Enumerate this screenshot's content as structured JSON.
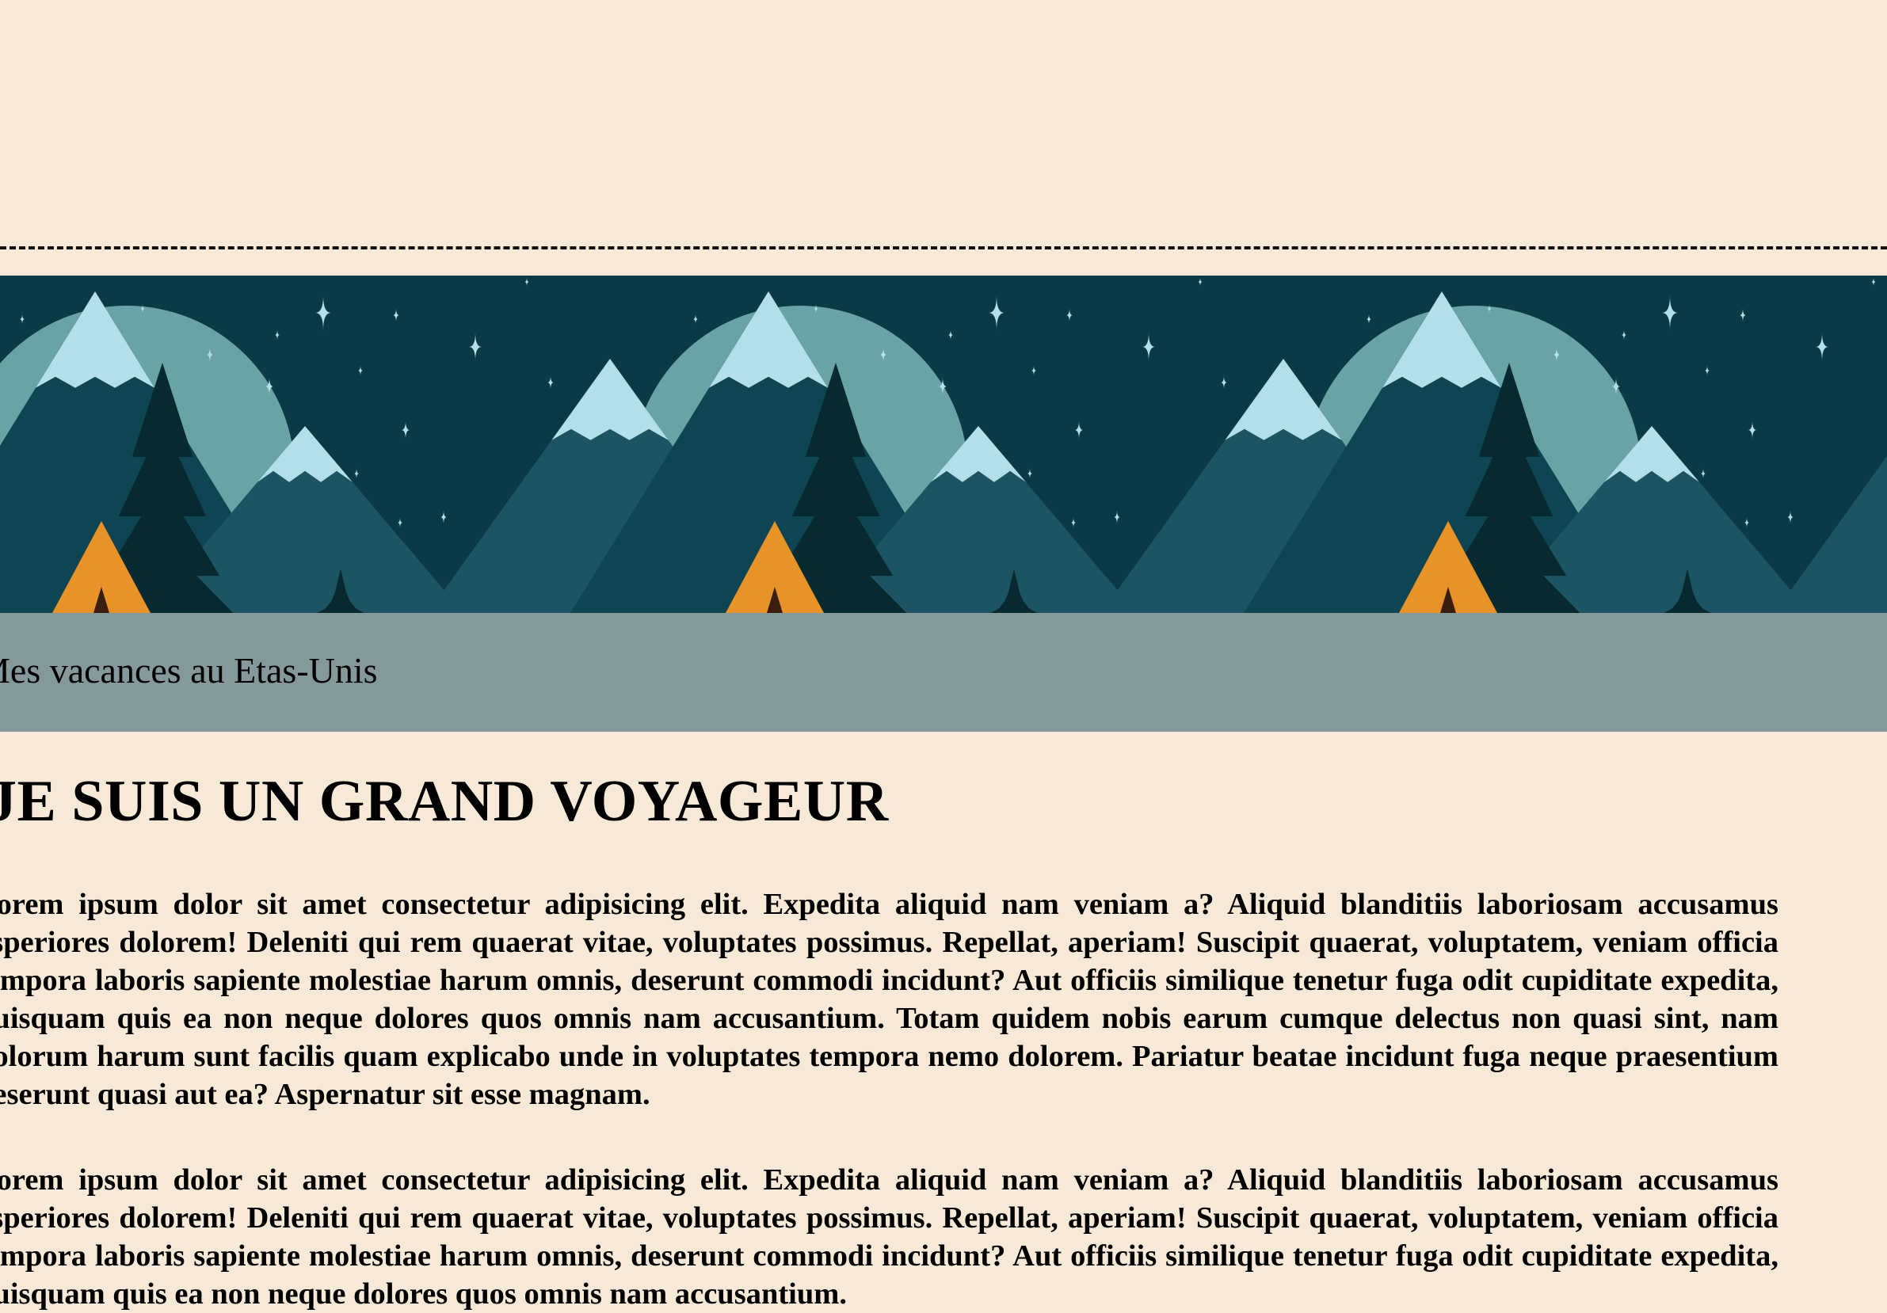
{
  "header": {
    "caption": "Mes vacances au Etas-Unis"
  },
  "main": {
    "title": "JE SUIS UN GRAND VOYAGEUR",
    "paragraphs": [
      "Lorem ipsum dolor sit amet consectetur adipisicing elit. Expedita aliquid nam veniam a? Aliquid blanditiis laboriosam accusamus asperiores dolorem! Deleniti qui rem quaerat vitae, voluptates possimus. Repellat, aperiam! Suscipit quaerat, voluptatem, veniam officia tempora laboris sapiente molestiae harum omnis, deserunt commodi incidunt? Aut officiis similique tenetur fuga odit cupiditate expedita, quisquam quis ea non neque dolores quos omnis nam accusantium. Totam quidem nobis earum cumque delectus non quasi sint, nam dolorum harum sunt facilis quam explicabo unde in voluptates tempora nemo dolorem. Pariatur beatae incidunt fuga neque praesentium deserunt quasi aut ea? Aspernatur sit esse magnam.",
      "Lorem ipsum dolor sit amet consectetur adipisicing elit. Expedita aliquid nam veniam a? Aliquid blanditiis laboriosam accusamus asperiores dolorem! Deleniti qui rem quaerat vitae, voluptates possimus. Repellat, aperiam! Suscipit quaerat, voluptatem, veniam officia tempora laboris sapiente molestiae harum omnis, deserunt commodi incidunt? Aut officiis similique tenetur fuga odit cupiditate expedita, quisquam quis ea non neque dolores quos omnis nam accusantium."
    ]
  },
  "colors": {
    "page_background": "#f7e9d7",
    "banner_sky": "#0b3a47",
    "caption_bar": "#85999c",
    "tent": "#e8922a",
    "snow": "#b3e0e8"
  },
  "icons": [
    "mountain-banner-illustration",
    "star-icon",
    "tent-icon",
    "pine-tree-icon"
  ]
}
